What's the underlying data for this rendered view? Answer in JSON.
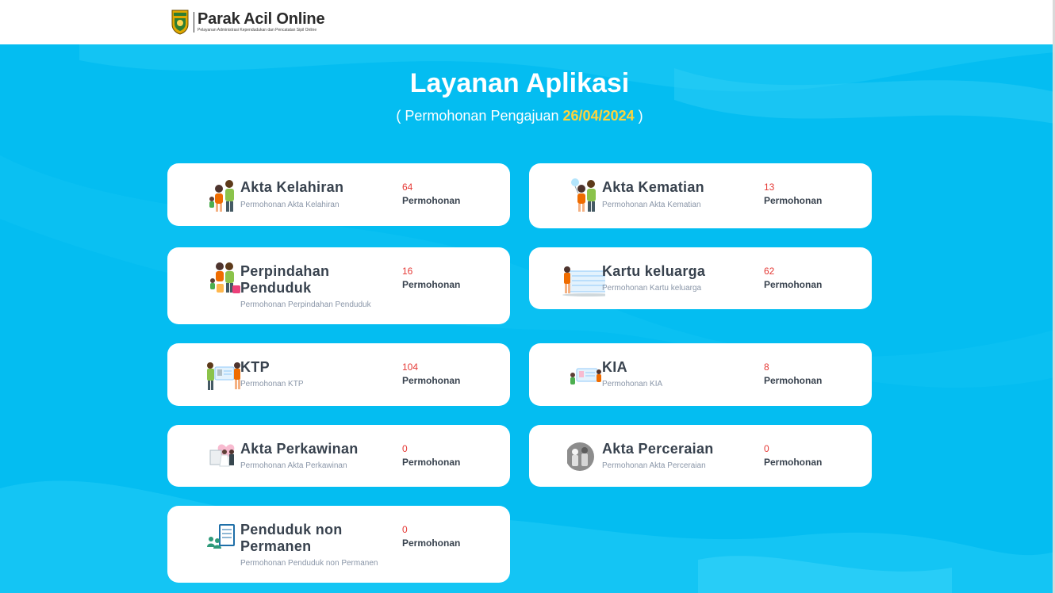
{
  "header": {
    "logo_title": "Parak Acil Online",
    "logo_subtitle": "Pelayanan Administrasi Kependudukan dan Pencatatan Sipil Online"
  },
  "hero": {
    "title": "Layanan Aplikasi",
    "subtitle_prefix": "( Permohonan Pengajuan ",
    "date": "26/04/2024",
    "subtitle_suffix": " )"
  },
  "colors": {
    "background": "#04bdf1",
    "date_highlight": "#ffd43b",
    "count": "#e53935",
    "card_title": "#38424e"
  },
  "services": [
    {
      "name": "Akta Kelahiran",
      "description": "Permohonan Akta Kelahiran",
      "count": "64",
      "unit": "Permohonan",
      "icon": "family-icon"
    },
    {
      "name": "Akta Kematian",
      "description": "Permohonan Akta Kematian",
      "count": "13",
      "unit": "Permohonan",
      "icon": "family-balloon-icon"
    },
    {
      "name": "Perpindahan Penduduk",
      "description": "Permohonan Perpindahan Penduduk",
      "count": "16",
      "unit": "Permohonan",
      "icon": "moving-family-icon"
    },
    {
      "name": "Kartu keluarga",
      "description": "Permohonan Kartu keluarga",
      "count": "62",
      "unit": "Permohonan",
      "icon": "family-card-icon"
    },
    {
      "name": "KTP",
      "description": "Permohonan KTP",
      "count": "104",
      "unit": "Permohonan",
      "icon": "id-card-icon"
    },
    {
      "name": "KIA",
      "description": "Permohonan KIA",
      "count": "8",
      "unit": "Permohonan",
      "icon": "child-id-card-icon"
    },
    {
      "name": "Akta Perkawinan",
      "description": "Permohonan Akta Perkawinan",
      "count": "0",
      "unit": "Permohonan",
      "icon": "wedding-icon"
    },
    {
      "name": "Akta Perceraian",
      "description": "Permohonan Akta Perceraian",
      "count": "0",
      "unit": "Permohonan",
      "icon": "divorce-icon"
    },
    {
      "name": "Penduduk non Permanen",
      "description": "Permohonan Penduduk non Permanen",
      "count": "0",
      "unit": "Permohonan",
      "icon": "document-people-icon"
    }
  ]
}
